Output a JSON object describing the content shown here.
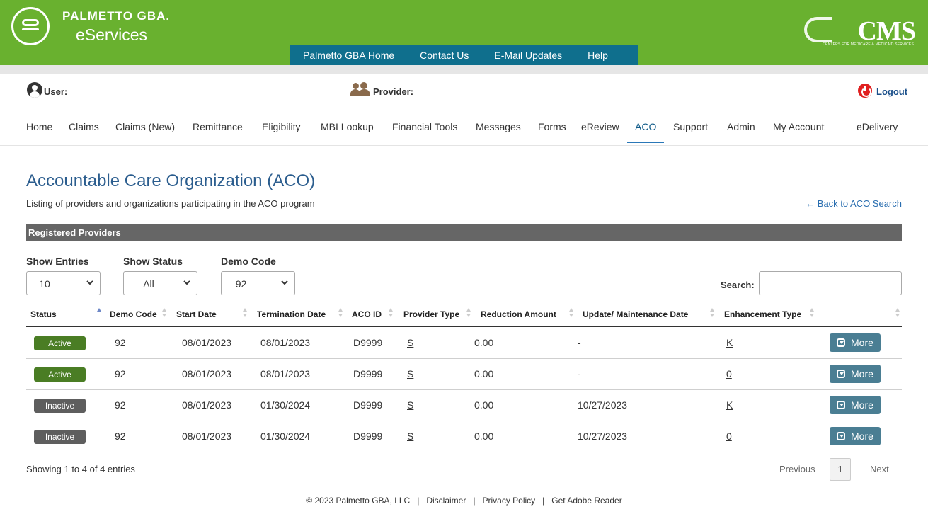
{
  "header": {
    "brand_top": "PALMETTO GBA.",
    "brand_bottom": "eServices",
    "cms_logo": "CMS",
    "cms_sub": "CENTERS FOR MEDICARE & MEDICAID SERVICES",
    "top_links": [
      "Palmetto GBA Home",
      "Contact Us",
      "E-Mail Updates",
      "Help"
    ],
    "colors": {
      "brand_green": "#69b12f",
      "topnav_teal": "#0f6f8d"
    }
  },
  "userbar": {
    "user_label": "User:",
    "provider_label": "Provider:",
    "logout_label": "Logout"
  },
  "nav": {
    "items": [
      "Home",
      "Claims",
      "Claims (New)",
      "Remittance",
      "Eligibility",
      "MBI Lookup",
      "Financial Tools",
      "Messages",
      "Forms",
      "eReview",
      "ACO",
      "Support",
      "Admin",
      "My Account",
      "eDelivery"
    ],
    "active": "ACO"
  },
  "page": {
    "title": "Accountable Care Organization (ACO)",
    "subtitle": "Listing of providers and organizations participating in the ACO program",
    "back_link": "← Back to ACO Search",
    "section_title": "Registered Providers"
  },
  "filters": {
    "show_entries_label": "Show Entries",
    "show_entries_value": "10",
    "show_status_label": "Show Status",
    "show_status_value": "All",
    "demo_code_label": "Demo Code",
    "demo_code_value": "92",
    "search_label": "Search:",
    "search_value": ""
  },
  "table": {
    "columns": [
      "Status",
      "Demo Code",
      "Start Date",
      "Termination Date",
      "ACO ID",
      "Provider Type",
      "Reduction Amount",
      "Update/ Maintenance Date",
      "Enhancement Type",
      ""
    ],
    "rows": [
      {
        "status": "Active",
        "demo_code": "92",
        "start_date": "08/01/2023",
        "termination_date": "08/01/2023",
        "aco_id": "D9999",
        "provider_type": "S",
        "reduction_amount": "0.00",
        "update_date": "-",
        "enhancement_type": "K",
        "action": "More"
      },
      {
        "status": "Active",
        "demo_code": "92",
        "start_date": "08/01/2023",
        "termination_date": "08/01/2023",
        "aco_id": "D9999",
        "provider_type": "S",
        "reduction_amount": "0.00",
        "update_date": "-",
        "enhancement_type": "0",
        "action": "More"
      },
      {
        "status": "Inactive",
        "demo_code": "92",
        "start_date": "08/01/2023",
        "termination_date": "01/30/2024",
        "aco_id": "D9999",
        "provider_type": "S",
        "reduction_amount": "0.00",
        "update_date": "10/27/2023",
        "enhancement_type": "K",
        "action": "More"
      },
      {
        "status": "Inactive",
        "demo_code": "92",
        "start_date": "08/01/2023",
        "termination_date": "01/30/2024",
        "aco_id": "D9999",
        "provider_type": "S",
        "reduction_amount": "0.00",
        "update_date": "10/27/2023",
        "enhancement_type": "0",
        "action": "More"
      }
    ],
    "status_colors": {
      "Active": "#4a7d24",
      "Inactive": "#5e5e5e"
    }
  },
  "pagination": {
    "summary": "Showing 1 to 4 of 4 entries",
    "previous": "Previous",
    "current_page": "1",
    "next": "Next"
  },
  "footer": {
    "copyright": "© 2023 Palmetto GBA, LLC",
    "disclaimer": "Disclaimer",
    "privacy": "Privacy Policy",
    "adobe": "Get Adobe Reader"
  }
}
